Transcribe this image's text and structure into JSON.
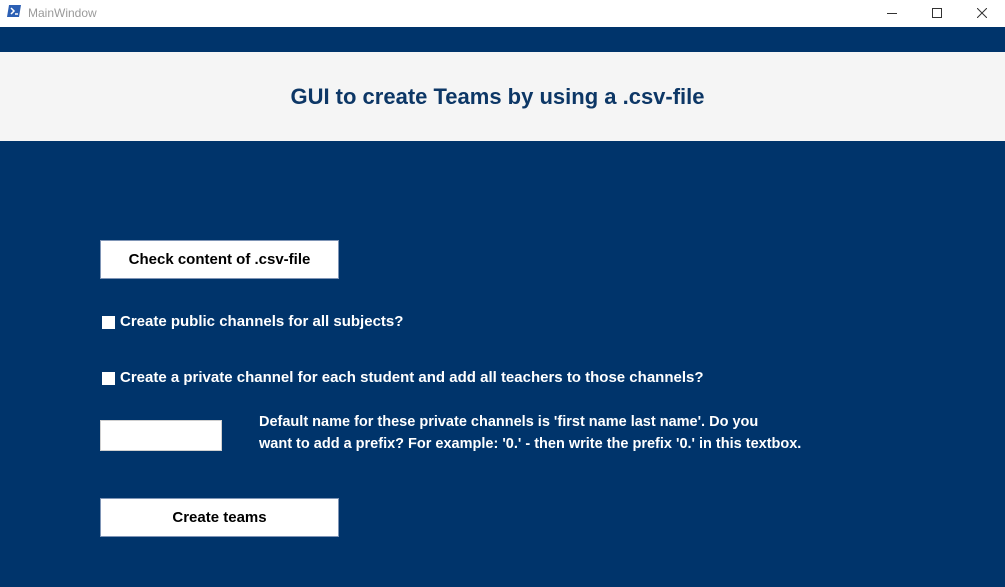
{
  "window": {
    "title": "MainWindow",
    "icon": "powershell-icon",
    "controls": [
      "minimize-icon",
      "maximize-icon",
      "close-icon"
    ]
  },
  "header": {
    "title": "GUI to create Teams by using a .csv-file"
  },
  "buttons": {
    "check_csv": "Check content of .csv-file",
    "create_teams": "Create teams"
  },
  "options": {
    "public_channels": {
      "label": "Create public channels for all subjects?",
      "checked": false
    },
    "private_channels": {
      "label": "Create a private channel for each student and add all teachers to those channels?",
      "checked": false
    }
  },
  "prefix": {
    "value": "",
    "hint_line1": "Default name for these private channels is 'first name last name'. Do you",
    "hint_line2": "want to add a prefix? For example: '0.' - then write the prefix '0.' in this textbox."
  },
  "colors": {
    "background": "#00346b",
    "header_band": "#f5f5f5",
    "title_text": "#0d3766"
  }
}
